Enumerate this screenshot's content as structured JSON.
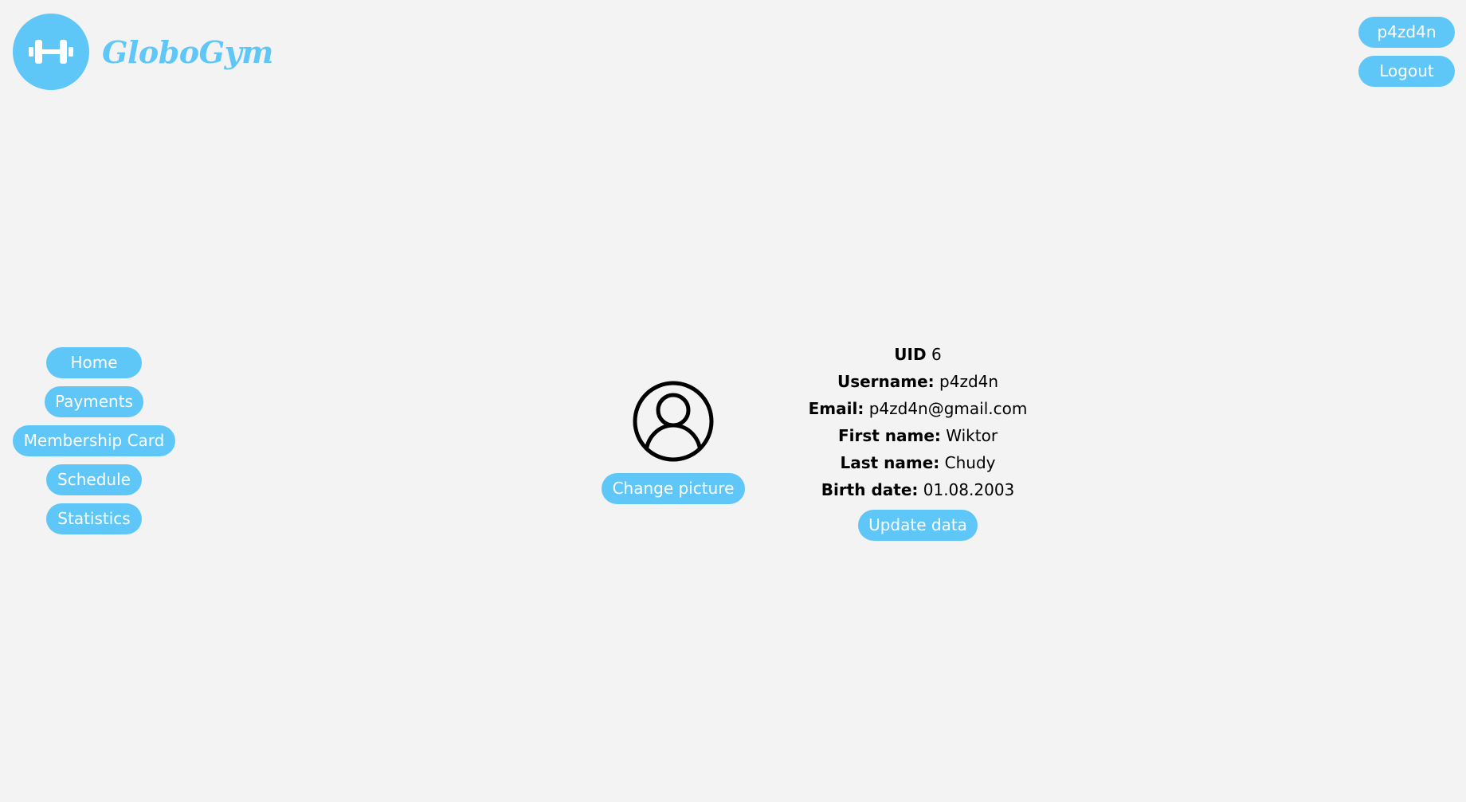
{
  "header": {
    "brand": "GloboGym",
    "logo_icon": "dumbbell-icon",
    "accent_color": "#5fc7f8"
  },
  "account": {
    "username_label": "p4zd4n",
    "logout_label": "Logout"
  },
  "sidebar": {
    "items": [
      {
        "label": "Home"
      },
      {
        "label": "Payments"
      },
      {
        "label": "Membership Card"
      },
      {
        "label": "Schedule"
      },
      {
        "label": "Statistics"
      }
    ]
  },
  "profile": {
    "avatar_icon": "user-circle-icon",
    "change_picture_label": "Change picture",
    "fields": [
      {
        "label": "UID",
        "value": "6"
      },
      {
        "label": "Username:",
        "value": "p4zd4n"
      },
      {
        "label": "Email:",
        "value": "p4zd4n@gmail.com"
      },
      {
        "label": "First name:",
        "value": "Wiktor"
      },
      {
        "label": "Last name:",
        "value": "Chudy"
      },
      {
        "label": "Birth date:",
        "value": "01.08.2003"
      }
    ],
    "update_label": "Update data"
  }
}
